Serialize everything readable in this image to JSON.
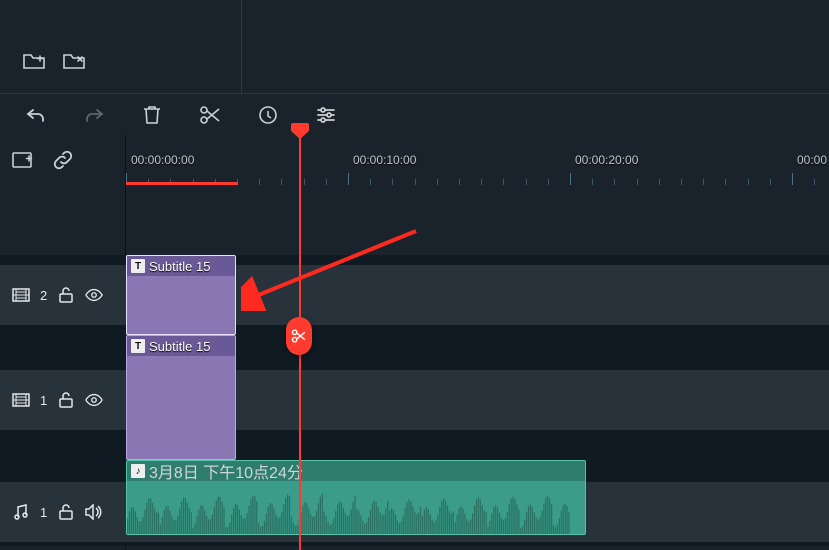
{
  "panels": {
    "tabs": []
  },
  "ruler": {
    "labels": [
      "00:00:00:00",
      "00:00:10:00",
      "00:00:20:00",
      "00:00"
    ]
  },
  "tracks": {
    "video1": {
      "num": "2",
      "clip": {
        "title": "Subtitle 15"
      }
    },
    "video2": {
      "num": "1",
      "clip": {
        "title": "Subtitle 15"
      }
    },
    "audio1": {
      "num": "1",
      "clip": {
        "title": "3月8日 下午10点24分"
      }
    }
  },
  "colors": {
    "accent_red": "#ff3b30",
    "clip_purple": "#8a77b3",
    "clip_purple_border": "#bba5e3",
    "audio_teal": "#3b9c8a"
  }
}
